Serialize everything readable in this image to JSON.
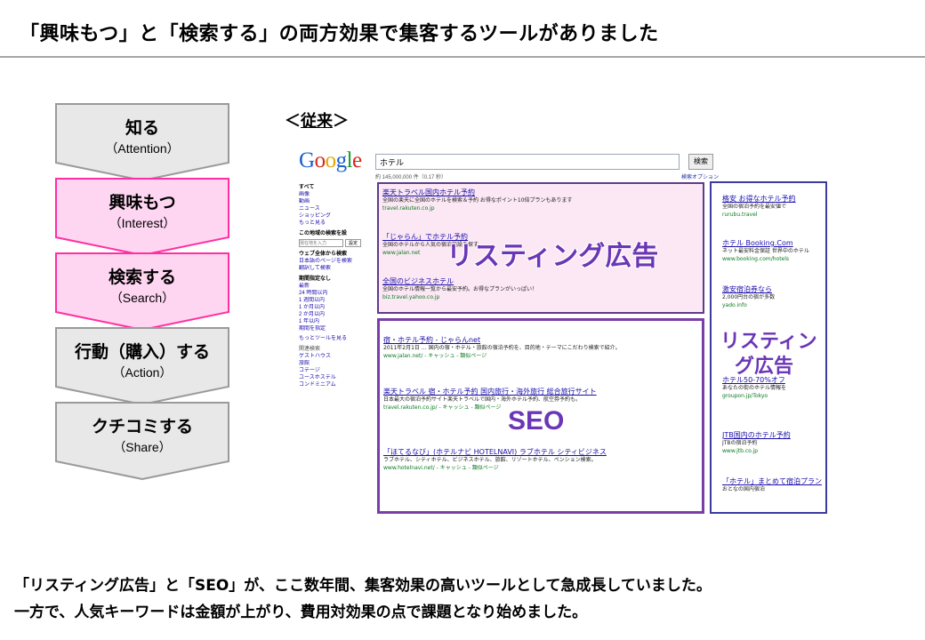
{
  "title": "「興味もつ」と「検索する」の両方効果で集客するツールがありました",
  "steps": [
    {
      "main": "知る",
      "sub": "（Attention）",
      "highlighted": false
    },
    {
      "main": "興味もつ",
      "sub": "（Interest）",
      "highlighted": true
    },
    {
      "main": "検索する",
      "sub": "（Search）",
      "highlighted": true
    },
    {
      "main": "行動（購入）する",
      "sub": "（Action）",
      "highlighted": false
    },
    {
      "main": "クチコミする",
      "sub": "（Share）",
      "highlighted": false
    }
  ],
  "conventional_label": "＜従来＞",
  "conventional_open": "＜",
  "conventional_word": "従来",
  "conventional_close": "＞",
  "colors": {
    "highlight_fill": "#ffd6f1",
    "highlight_border": "#ff2fa3",
    "normal_fill": "#e8e8e8",
    "normal_border": "#9a9a9a",
    "box": "#6b36b6"
  },
  "serp": {
    "logo": "Google",
    "query": "ホテル",
    "search_button": "検索",
    "stats": "約 145,000,000 件（0.17 秒）",
    "options": "検索オプション",
    "nav_items": [
      "すべて",
      "画像",
      "動画",
      "ニュース",
      "ショッピング",
      "もっと見る"
    ],
    "nav_heading_place": "この地域の検索を設",
    "place_value": "現在地を入力",
    "place_button": "設定",
    "nav_heading_web": "ウェブ全体から検索",
    "nav_web_items": [
      "日本語のページを検索",
      "翻訳して検索"
    ],
    "nav_heading_period": "期間指定なし",
    "nav_period_items": [
      "最新",
      "24 時間以内",
      "1 週間以内",
      "1 か月以内",
      "2 か月以内",
      "1 年以内",
      "期間を指定"
    ],
    "nav_more": "もっとツールを見る",
    "nav_heading_related": "関連検索",
    "nav_related_items": [
      "ゲストハウス",
      "旅館",
      "コテージ",
      "ユースホステル",
      "コンドミニアム"
    ],
    "ads": [
      {
        "title": "楽天トラベル国内ホテル予約",
        "desc": "全国の楽天に全国のホテルを検索＆予約 お得なポイント10倍プランもあります",
        "url": "travel.rakuten.co.jp"
      },
      {
        "title": "「じゃらん」でホテル予約",
        "desc": "全国のホテルから人気の宿泊施設を探す",
        "url": "www.jalan.net"
      },
      {
        "title": "全国のビジネスホテル",
        "desc": "全国のホテル情報一覧から最安予約。お得なプランがいっぱい！",
        "url": "biz.travel.yahoo.co.jp"
      }
    ],
    "organic": [
      {
        "title": "宿・ホテル予約 - じゃらんnet",
        "desc": "2011年2月1日 … 国内の宿・ホテル・旅館の宿泊予約を、目的地・テーマにこだわり検索で紹介。",
        "url": "www.jalan.net/ - キャッシュ - 類似ページ"
      },
      {
        "title": "楽天トラベル 宿・ホテル予約 国内旅行・海外旅行 総合旅行サイト",
        "desc": "日本最大の宿泊予約サイト楽天トラベルで国内・海外ホテル予約、航空券予約も。",
        "url": "travel.rakuten.co.jp/ - キャッシュ - 類似ページ"
      },
      {
        "title": "「ほてるなび」(ホテルナビ HOTELNAVI) ラブホテル シティビジネス",
        "desc": "ラブホテル、シティホテル、ビジネスホテル、旅館、リゾートホテル、ペンション検索。",
        "url": "www.hotelnavi.net/ - キャッシュ - 類似ページ"
      }
    ],
    "side_ads": [
      {
        "title": "格安 お得なホテル予約",
        "desc": "全国の宿泊予約を最安値で",
        "url": "rurubu.travel"
      },
      {
        "title": "ホテル Booking.Com",
        "desc": "ネット最安料金保証 世界中のホテル",
        "url": "www.booking.com/hotels"
      },
      {
        "title": "激安宿泊券なら",
        "desc": "2,000円台の宿が多数",
        "url": "yado.info"
      },
      {
        "title": "ホテル50-70%オフ",
        "desc": "あなたの街のホテル情報を",
        "url": "groupon.jp/Tokyo"
      },
      {
        "title": "JTB国内のホテル予約",
        "desc": "JTBの宿泊予約",
        "url": "www.jtb.co.jp"
      },
      {
        "title": "「ホテル」まとめて宿泊プラン比較",
        "desc": "おとなの国内宿泊",
        "url": ""
      }
    ],
    "label_listing": "リスティング広告",
    "label_seo": "SEO",
    "label_side_1": "リスティン",
    "label_side_2": "グ広告"
  },
  "bottom_line_1": "「リスティング広告」と「SEO」が、ここ数年間、集客効果の高いツールとして急成長していました。",
  "bottom_line_2": "一方で、人気キーワードは金額が上がり、費用対効果の点で課題となり始めました。"
}
